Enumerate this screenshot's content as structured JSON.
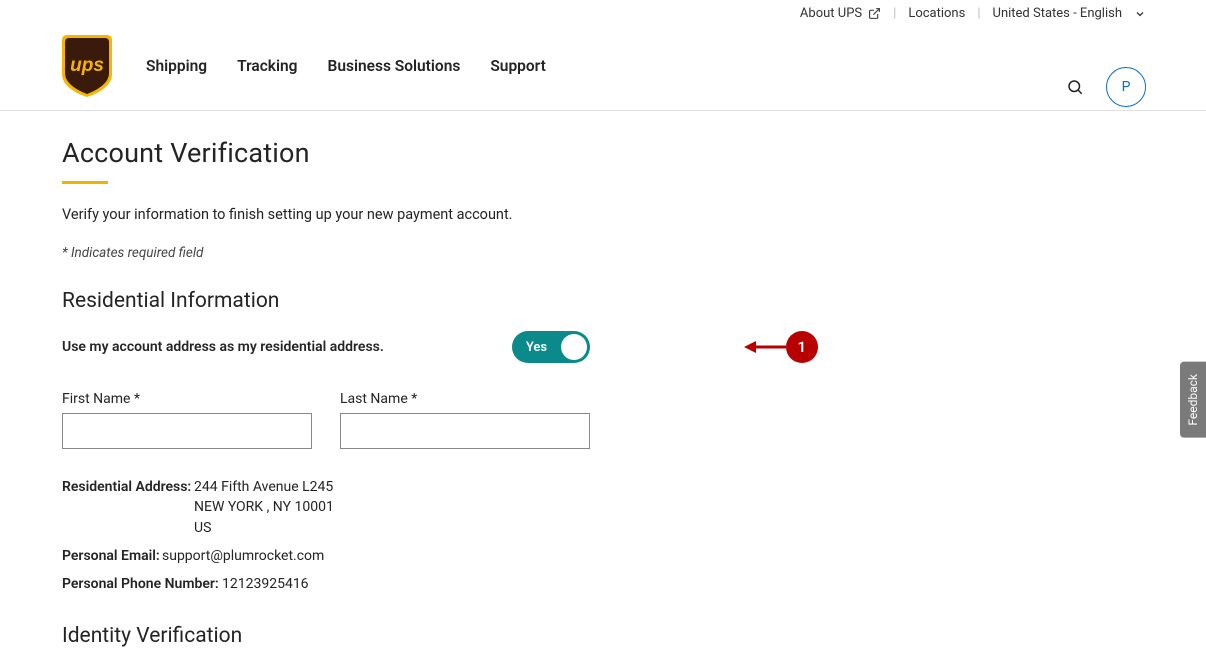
{
  "topbar": {
    "about": "About UPS",
    "locations": "Locations",
    "locale": "United States - English"
  },
  "nav": {
    "shipping": "Shipping",
    "tracking": "Tracking",
    "business": "Business Solutions",
    "support": "Support"
  },
  "avatar": {
    "initial": "P"
  },
  "page": {
    "title": "Account Verification",
    "intro": "Verify your information to finish setting up your new payment account.",
    "required_note": "* Indicates required field"
  },
  "residential": {
    "heading": "Residential Information",
    "toggle_label": "Use my account address as my residential address.",
    "toggle_state": "Yes",
    "first_name_label": "First Name *",
    "last_name_label": "Last Name *",
    "first_name_value": "",
    "last_name_value": "",
    "address_label": "Residential Address:",
    "address_line1": "244 Fifth Avenue L245",
    "address_line2": "NEW YORK , NY 10001",
    "address_line3": "US",
    "email_label": "Personal Email:",
    "email_value": "support@plumrocket.com",
    "phone_label": "Personal Phone Number:",
    "phone_value": "12123925416"
  },
  "identity": {
    "heading": "Identity Verification"
  },
  "annotation": {
    "number": "1"
  },
  "feedback": {
    "label": "Feedback"
  }
}
